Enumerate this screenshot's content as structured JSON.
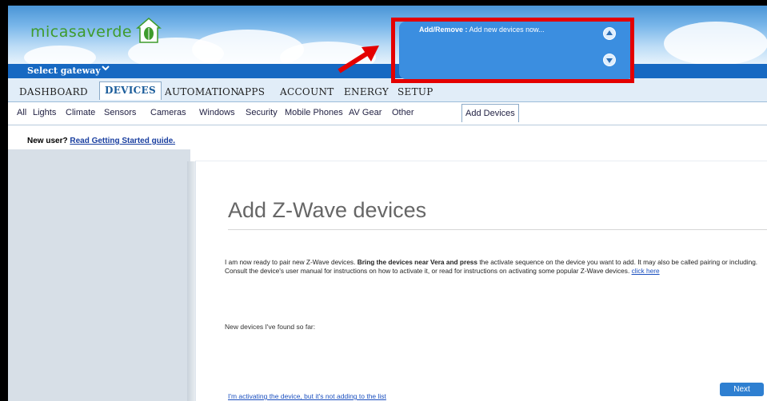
{
  "brand": {
    "logo_text": "micasaverde",
    "logo_icon": "house-leaf-icon"
  },
  "gateway": {
    "label": "Select gateway",
    "icon": "chevron-down-icon"
  },
  "main_nav": [
    {
      "label": "DASHBOARD"
    },
    {
      "label": "DEVICES",
      "active": true
    },
    {
      "label": "AUTOMATION"
    },
    {
      "label": "APPS"
    },
    {
      "label": "ACCOUNT"
    },
    {
      "label": "ENERGY"
    },
    {
      "label": "SETUP"
    }
  ],
  "sub_nav": [
    {
      "label": "All"
    },
    {
      "label": "Lights"
    },
    {
      "label": "Climate"
    },
    {
      "label": "Sensors"
    },
    {
      "label": "Cameras"
    },
    {
      "label": "Windows"
    },
    {
      "label": "Security"
    },
    {
      "label": "Mobile Phones"
    },
    {
      "label": "AV Gear"
    },
    {
      "label": "Other"
    },
    {
      "label": "Add Devices",
      "active": true
    }
  ],
  "new_user": {
    "prefix": "New user?",
    "link": "Read Getting Started guide."
  },
  "status_panel": {
    "label": "Add/Remove :",
    "message": "Add new devices now...",
    "up_icon": "arrow-up-icon",
    "down_icon": "arrow-down-icon"
  },
  "annotation": {
    "highlight_color": "#e40000",
    "arrow_icon": "red-arrow-icon"
  },
  "content": {
    "title": "Add Z-Wave devices",
    "para_start": "I am now ready to pair new Z-Wave devices. ",
    "para_bold": "Bring the devices near Vera and press",
    "para_rest": " the activate sequence on the device you want to add. It may also be called pairing or including. Consult the device's user manual for instructions on how to activate it, or read for instructions on activating some popular Z-Wave devices. ",
    "para_link": "click here",
    "found_label": "New devices I've found so far:",
    "help_link": "I'm activating the device, but it's not adding to the list",
    "next_label": "Next"
  },
  "colors": {
    "brand_green": "#3e9b2c",
    "nav_blue": "#1769c2",
    "link_blue": "#1a4fbf",
    "button_blue": "#2e7fd1"
  }
}
